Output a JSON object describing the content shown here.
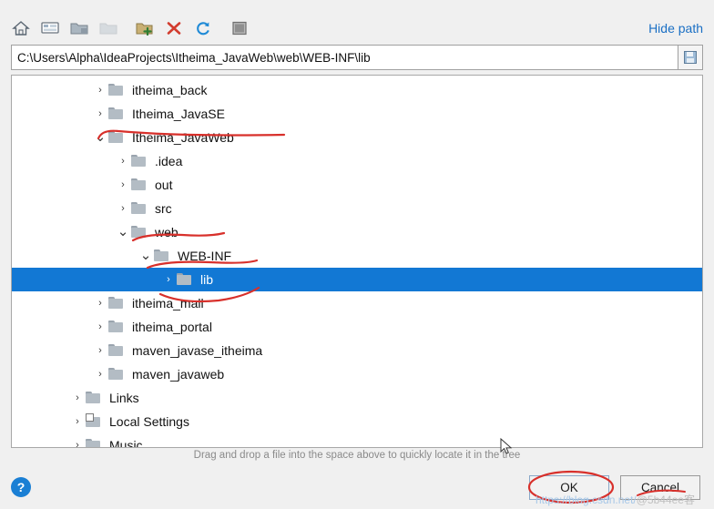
{
  "toolbar": {
    "buttons": [
      {
        "name": "home-icon",
        "title": "Home"
      },
      {
        "name": "desktop-icon",
        "title": "Desktop"
      },
      {
        "name": "folder-icon",
        "title": "Project folder"
      },
      {
        "name": "folder-disabled-icon",
        "title": "Module folder"
      },
      {
        "name": "new-folder-icon",
        "title": "New Folder"
      },
      {
        "name": "delete-icon",
        "title": "Delete"
      },
      {
        "name": "refresh-icon",
        "title": "Refresh"
      },
      {
        "name": "show-hidden-icon",
        "title": "Show Hidden Files"
      }
    ],
    "hide_path_label": "Hide path"
  },
  "path": {
    "value": "C:\\Users\\Alpha\\IdeaProjects\\Itheima_JavaWeb\\web\\WEB-INF\\lib",
    "save_icon": "floppy-icon"
  },
  "tree": {
    "nodes": [
      {
        "label": "itheima_back",
        "indent": 2,
        "arrow": "collapsed",
        "icon": "folder",
        "selected": false
      },
      {
        "label": "Itheima_JavaSE",
        "indent": 2,
        "arrow": "collapsed",
        "icon": "folder",
        "selected": false
      },
      {
        "label": "Itheima_JavaWeb",
        "indent": 2,
        "arrow": "expanded",
        "icon": "folder",
        "selected": false
      },
      {
        "label": ".idea",
        "indent": 3,
        "arrow": "collapsed",
        "icon": "folder",
        "selected": false
      },
      {
        "label": "out",
        "indent": 3,
        "arrow": "collapsed",
        "icon": "folder",
        "selected": false
      },
      {
        "label": "src",
        "indent": 3,
        "arrow": "collapsed",
        "icon": "folder",
        "selected": false
      },
      {
        "label": "web",
        "indent": 3,
        "arrow": "expanded",
        "icon": "folder",
        "selected": false
      },
      {
        "label": "WEB-INF",
        "indent": 4,
        "arrow": "expanded",
        "icon": "folder",
        "selected": false
      },
      {
        "label": "lib",
        "indent": 5,
        "arrow": "collapsed",
        "icon": "folder",
        "selected": true
      },
      {
        "label": "itheima_mall",
        "indent": 2,
        "arrow": "collapsed",
        "icon": "folder",
        "selected": false
      },
      {
        "label": "itheima_portal",
        "indent": 2,
        "arrow": "collapsed",
        "icon": "folder",
        "selected": false
      },
      {
        "label": "maven_javase_itheima",
        "indent": 2,
        "arrow": "collapsed",
        "icon": "folder",
        "selected": false
      },
      {
        "label": "maven_javaweb",
        "indent": 2,
        "arrow": "collapsed",
        "icon": "folder",
        "selected": false
      },
      {
        "label": "Links",
        "indent": 1,
        "arrow": "collapsed",
        "icon": "folder",
        "selected": false
      },
      {
        "label": "Local Settings",
        "indent": 1,
        "arrow": "collapsed",
        "icon": "folder-link",
        "selected": false
      },
      {
        "label": "Music",
        "indent": 1,
        "arrow": "collapsed",
        "icon": "folder",
        "selected": false
      }
    ]
  },
  "hint": "Drag and drop a file into the space above to quickly locate it in the tree",
  "footer": {
    "help_label": "?",
    "ok_label": "OK",
    "cancel_label": "Cancel"
  },
  "watermark": {
    "prefix": "https://blog.csdn.net/",
    "suffix": "@5b44ee客"
  },
  "colors": {
    "selection": "#1278d4",
    "link": "#1a6fc4",
    "annotation": "#d8302b"
  }
}
